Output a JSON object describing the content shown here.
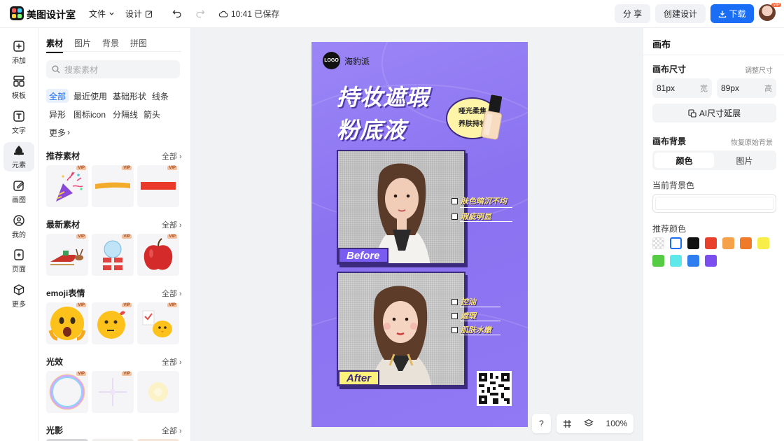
{
  "app": {
    "name": "美图设计室"
  },
  "topbar": {
    "file_label": "文件",
    "design_label": "设计",
    "save_status": "10:41 已保存",
    "share_label": "分 享",
    "create_label": "创建设计",
    "download_label": "下载",
    "avatar_badge": "VIP"
  },
  "rail": {
    "items": [
      {
        "label": "添加",
        "icon": "plus-square-icon"
      },
      {
        "label": "模板",
        "icon": "template-icon"
      },
      {
        "label": "文字",
        "icon": "text-icon"
      },
      {
        "label": "元素",
        "icon": "shapes-icon"
      },
      {
        "label": "画图",
        "icon": "pencil-icon"
      },
      {
        "label": "我的",
        "icon": "user-icon"
      },
      {
        "label": "页面",
        "icon": "page-add-icon"
      },
      {
        "label": "更多",
        "icon": "cube-icon"
      }
    ],
    "active": "元素"
  },
  "panel": {
    "tabs": [
      "素材",
      "图片",
      "背景",
      "拼图"
    ],
    "active_tab": "素材",
    "search_placeholder": "搜索素材",
    "chips": [
      "全部",
      "最近使用",
      "基础形状",
      "线条",
      "异形",
      "图标icon",
      "分隔线",
      "箭头",
      "更多"
    ],
    "active_chip": "全部",
    "vip_badge": "VIP",
    "sections": [
      {
        "title": "推荐素材",
        "all": "全部"
      },
      {
        "title": "最新素材",
        "all": "全部"
      },
      {
        "title": "emoji表情",
        "all": "全部"
      },
      {
        "title": "光效",
        "all": "全部"
      },
      {
        "title": "光影",
        "all": "全部"
      }
    ]
  },
  "poster": {
    "logo_text": "LOGO",
    "brand": "海豹派",
    "headline_1": "持妆遮瑕",
    "headline_2": "粉底液",
    "bubble_1": "哑光柔焦",
    "bubble_2": "养肤持妆",
    "before_tag": "Before",
    "after_tag": "After",
    "before_points": [
      "肤色暗沉不均",
      "瑕疵明显"
    ],
    "after_points": [
      "控油",
      "遮瑕",
      "肌肤水嫩"
    ],
    "colors": {
      "bg": "#8f79f5",
      "outline": "#3b2a7d",
      "tag_before": "#7b5cf0",
      "tag_after": "#fff27a"
    }
  },
  "zoom": {
    "help": "?",
    "level": "100%"
  },
  "props": {
    "title": "画布",
    "size_label": "画布尺寸",
    "size_link": "调整尺寸",
    "width_value": "81px",
    "width_unit": "宽",
    "height_value": "89px",
    "height_unit": "高",
    "ai_button": "AI尺寸延展",
    "bg_label": "画布背景",
    "bg_link": "恢复原始背景",
    "seg_color": "颜色",
    "seg_image": "图片",
    "current_label": "当前背景色",
    "current_color": "#ffffff",
    "recommend_label": "推荐颜色",
    "swatches": [
      "transparent",
      "#ffffff",
      "#111111",
      "#e8402a",
      "#f5a24a",
      "#ef7a2a",
      "#f7ee4a",
      "#55cc44",
      "#5fe8ea",
      "#2f7ef0",
      "#7b4ef0"
    ]
  }
}
